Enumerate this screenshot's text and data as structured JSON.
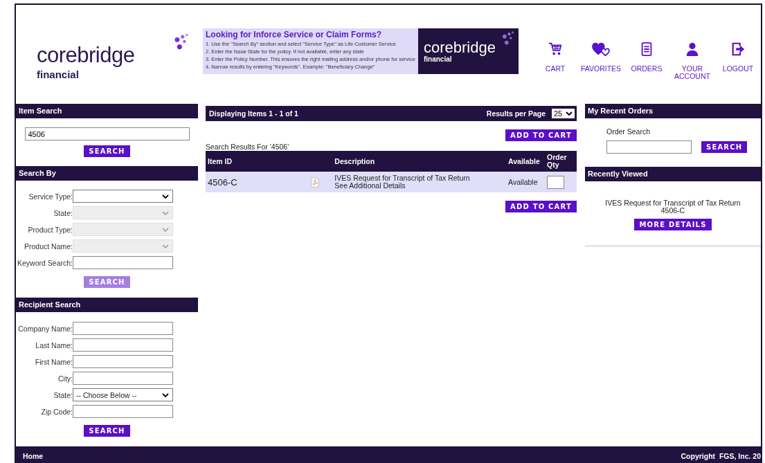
{
  "header": {
    "logo": {
      "name": "corebridge",
      "tagline": "financial"
    },
    "banner": {
      "title": "Looking for Inforce Service or Claim Forms?",
      "steps": [
        "1. Use the \"Search By\" section and select \"Service Type\" as Life Customer Service",
        "2. Enter the Issue State for the policy. If not available, enter any state",
        "3. Enter the Policy Number. This ensures the right mailing address and/or phone for service",
        "4. Narrow results by entering \"Keywords\". Example: \"Beneficiary Change\""
      ],
      "logo": {
        "name": "corebridge",
        "tagline": "financial"
      }
    },
    "nav": [
      "CART",
      "FAVORITES",
      "ORDERS",
      "YOUR ACCOUNT",
      "LOGOUT"
    ]
  },
  "item_search": {
    "title": "Item Search",
    "value": "4506",
    "button": {
      "label": "SEARCH",
      "disabled": false
    }
  },
  "search_by": {
    "title": "Search By",
    "fields": [
      {
        "label": "Service Type:",
        "kind": "select",
        "disabled": false
      },
      {
        "label": "State:",
        "kind": "select",
        "disabled": true
      },
      {
        "label": "Product Type:",
        "kind": "select",
        "disabled": true
      },
      {
        "label": "Product Name:",
        "kind": "select",
        "disabled": true
      },
      {
        "label": "Keyword Search:",
        "kind": "text",
        "disabled": false
      }
    ],
    "button": {
      "label": "SEARCH",
      "disabled": true
    }
  },
  "recipient_search": {
    "title": "Recipient Search",
    "fields": [
      {
        "label": "Company Name:",
        "kind": "text",
        "disabled": false
      },
      {
        "label": "Last Name:",
        "kind": "text",
        "disabled": false
      },
      {
        "label": "First Name:",
        "kind": "text",
        "disabled": false
      },
      {
        "label": "City:",
        "kind": "text",
        "disabled": false
      },
      {
        "label": "State:",
        "kind": "select",
        "disabled": false,
        "value": "-- Choose Below --"
      },
      {
        "label": "Zip Code:",
        "kind": "text",
        "disabled": false
      }
    ],
    "button": {
      "label": "SEARCH",
      "disabled": false
    }
  },
  "results": {
    "summary": "Displaying Items 1 - 1 of 1",
    "per_page_label": "Results per Page",
    "per_page": "25",
    "add_to_cart_top": "ADD TO CART",
    "caption": "Search Results For '4506'",
    "columns": [
      "Item ID",
      "Description",
      "Available",
      "Order Qty"
    ],
    "rows": [
      {
        "item_id": "4506-C",
        "description": "IVES Request for Transcript of Tax Return",
        "link": "See Additional Details",
        "available": "Available"
      }
    ],
    "add_to_cart_bottom": "ADD TO CART"
  },
  "recent_orders": {
    "title": "My Recent Orders",
    "label": "Order Search",
    "button": "SEARCH"
  },
  "recently_viewed": {
    "title": "Recently Viewed",
    "item_name": "IVES Request for Transcript of Tax Return",
    "item_id": "4506-C",
    "button": "MORE DETAILS"
  },
  "footer": {
    "link": "Home",
    "copyright": "Copyright  FGS, Inc. 20"
  }
}
